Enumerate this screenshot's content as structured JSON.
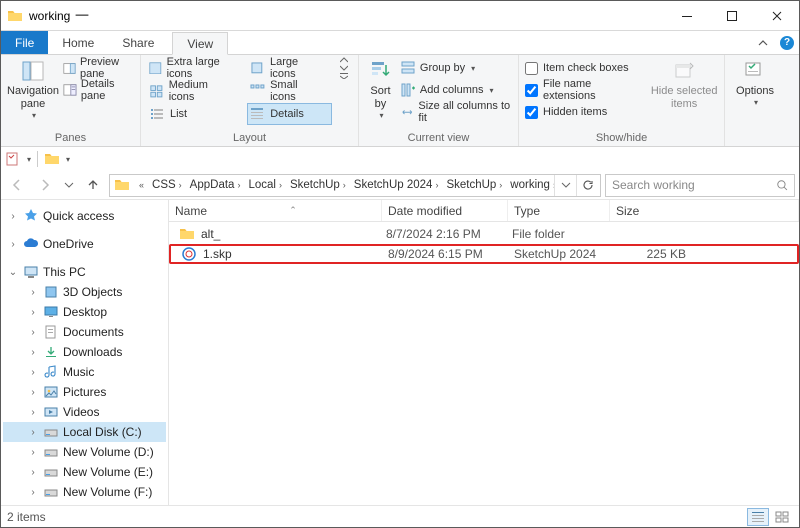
{
  "window": {
    "title": "working"
  },
  "menus": {
    "file": "File",
    "home": "Home",
    "share": "Share",
    "view": "View"
  },
  "ribbon": {
    "panes": {
      "navpane": "Navigation\npane",
      "preview": "Preview pane",
      "details": "Details pane",
      "group_label": "Panes"
    },
    "layout": {
      "extra_large": "Extra large icons",
      "large": "Large icons",
      "medium": "Medium icons",
      "small": "Small icons",
      "list": "List",
      "details": "Details",
      "group_label": "Layout"
    },
    "current_view": {
      "sort": "Sort\nby",
      "group_by": "Group by",
      "add_columns": "Add columns",
      "size_all": "Size all columns to fit",
      "group_label": "Current view"
    },
    "showhide": {
      "item_check": "Item check boxes",
      "file_ext": "File name extensions",
      "hidden": "Hidden items",
      "hide_sel": "Hide selected\nitems",
      "group_label": "Show/hide"
    },
    "options": {
      "label": "Options"
    }
  },
  "breadcrumbs": [
    "CSS",
    "AppData",
    "Local",
    "SketchUp",
    "SketchUp 2024",
    "SketchUp",
    "working"
  ],
  "search": {
    "placeholder": "Search working"
  },
  "columns": {
    "name": "Name",
    "date": "Date modified",
    "type": "Type",
    "size": "Size"
  },
  "files": [
    {
      "name": "alt_",
      "date": "8/7/2024 2:16 PM",
      "type": "File folder",
      "size": "",
      "icon": "folder",
      "highlight": false
    },
    {
      "name": "1.skp",
      "date": "8/9/2024 6:15 PM",
      "type": "SketchUp 2024",
      "size": "225 KB",
      "icon": "skp",
      "highlight": true
    }
  ],
  "nav": {
    "quick_access": "Quick access",
    "onedrive": "OneDrive",
    "this_pc": "This PC",
    "folders": [
      "3D Objects",
      "Desktop",
      "Documents",
      "Downloads",
      "Music",
      "Pictures",
      "Videos"
    ],
    "drives": [
      "Local Disk (C:)",
      "New Volume (D:)",
      "New Volume (E:)",
      "New Volume (F:)"
    ]
  },
  "status": {
    "count": "2 items"
  },
  "checked": {
    "file_ext": true,
    "hidden": true,
    "item_check": false
  }
}
